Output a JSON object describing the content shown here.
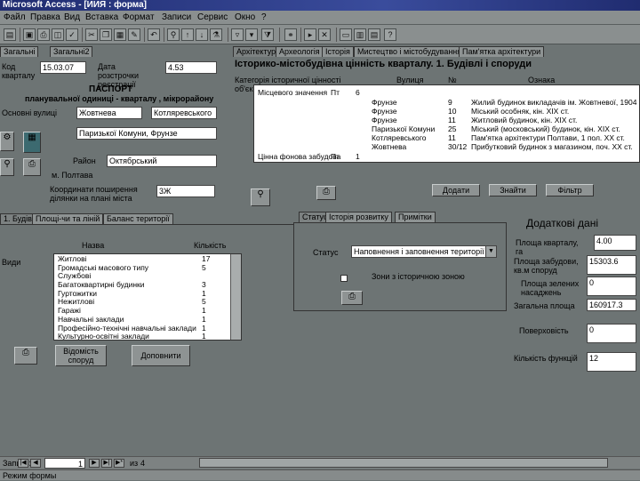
{
  "window": {
    "title": "Microsoft Access - [ИИЯ : форма]"
  },
  "menu": [
    "Файл",
    "Правка",
    "Вид",
    "Вставка",
    "Формат",
    "Записи",
    "Сервис",
    "Окно",
    "?"
  ],
  "top_tabs": [
    "Загальні",
    "Загальні2",
    "Архітектура",
    "Археологія",
    "Історія",
    "Мистецтво і містобудування",
    "Пам'ятка архітектури"
  ],
  "form": {
    "kod_label": "Код кварталу",
    "kod_value": "15.03.07",
    "date_label": "Дата розстрочки реєстрації",
    "date_value": "4.53",
    "passport_title": "ПАСПОРТ",
    "passport_sub": "планувальної одиниці - кварталу , мікрорайону",
    "main_streets_label": "Основні вулиці",
    "street1": "Жовтнева",
    "street2": "Котляревського",
    "street3": "Паризької Комуни, Фрунзе",
    "district_label": "Район",
    "district_value": "Октябрський",
    "city_label": "м. Полтава",
    "coord_label": "Координати поширення ділянки на плані міста",
    "coord_value": "3Ж"
  },
  "top_grid": {
    "heading": "Історико-містобудівна цінність кварталу. 1. Будівлі і споруди",
    "col_category": "Категорія історичної цінності об'єк",
    "col_street": "Вулиця",
    "col_number": "№",
    "col_feature": "Ознака",
    "rows": [
      {
        "category": "Місцевого значення",
        "code": "Пт",
        "count": "6",
        "street": "",
        "number": "",
        "feature": ""
      },
      {
        "category": "",
        "code": "",
        "count": "",
        "street": "Фрунзе",
        "number": "9",
        "feature": "Жилий будинок викладачів ім. Жовтневої, 1904 р."
      },
      {
        "category": "",
        "code": "",
        "count": "",
        "street": "Фрунзе",
        "number": "10",
        "feature": "Міський особняк, кін. XIX ст."
      },
      {
        "category": "",
        "code": "",
        "count": "",
        "street": "Фрунзе",
        "number": "11",
        "feature": "Житловий будинок, кін. XIX ст."
      },
      {
        "category": "",
        "code": "",
        "count": "",
        "street": "Паризької Комуни",
        "number": "25",
        "feature": "Міський (московський) будинок, кін. XIX ст."
      },
      {
        "category": "",
        "code": "",
        "count": "",
        "street": "Котляревського",
        "number": "11",
        "feature": "Пам'ятка архітектури Полтави, 1 пол. ХХ ст."
      },
      {
        "category": "",
        "code": "",
        "count": "",
        "street": "Жовтнева",
        "number": "30/12",
        "feature": "Прибутковий будинок з магазином, поч. XX ст."
      },
      {
        "category": "Цінна фонова забудова",
        "code": "Пт",
        "count": "1",
        "street": "",
        "number": "",
        "feature": ""
      }
    ]
  },
  "action_buttons": {
    "add": "Додати",
    "delete": "Знайти",
    "find": "Фільтр"
  },
  "left_tabs": [
    "1. Будівлі",
    "Площі-чи та ліній",
    "Баланс території"
  ],
  "list": {
    "col_name": "Назва",
    "col_count": "Кількість",
    "left_label": "Види",
    "rows": [
      {
        "name": "Житлові",
        "count": "17"
      },
      {
        "name": "Громадські масового типу",
        "count": "5"
      },
      {
        "name": "Службові",
        "count": ""
      },
      {
        "name": "Багатоквартирні будинки",
        "count": "3"
      },
      {
        "name": "Гуртожитки",
        "count": "1"
      },
      {
        "name": "Нежитлові",
        "count": "5"
      },
      {
        "name": "Гаражі",
        "count": "1"
      },
      {
        "name": "Навчальні заклади",
        "count": "1"
      },
      {
        "name": "Професійно-технічні навчальні заклади",
        "count": "1"
      },
      {
        "name": "Культурно-освітні заклади",
        "count": "1"
      }
    ],
    "btn_accounting": "Відомість споруд",
    "btn_more": "Доповнити"
  },
  "right_tabs": [
    "Статус",
    "Історія розвитку",
    "Примітки"
  ],
  "status": {
    "status_label": "Статус",
    "status_value": "Наповнення і заповнення території",
    "checkbox_label": "Зони з історичною зоною"
  },
  "extra": {
    "title": "Додаткові дані",
    "quarter_area_label": "Площа кварталу, га",
    "quarter_area_value": "4.00",
    "built_area_label": "Площа забудови, кв.м споруд",
    "built_area_value": "15303.6",
    "green_area_label": "Площа зелених насаджень",
    "green_area_value": "0",
    "total_area_label": "Загальна площа",
    "total_area_value": "160917.3",
    "floors_label": "Поверховість",
    "floors_value": "0",
    "functions_label": "Кількість функцій",
    "functions_value": "12"
  },
  "nav": {
    "record_label": "Запись:",
    "record_value": "1",
    "of_label": "из",
    "of_value": "4"
  },
  "status_bar": {
    "text": "Режим формы"
  }
}
